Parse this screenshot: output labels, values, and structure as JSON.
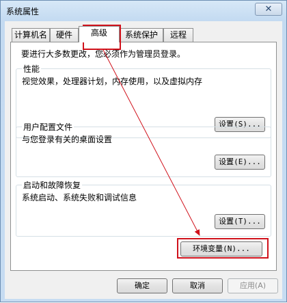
{
  "window": {
    "title": "系统属性",
    "close_glyph": "✕"
  },
  "tabs": [
    {
      "label": "计算机名",
      "active": false
    },
    {
      "label": "硬件",
      "active": false
    },
    {
      "label": "高级",
      "active": true
    },
    {
      "label": "系统保护",
      "active": false
    },
    {
      "label": "远程",
      "active": false
    }
  ],
  "admin_note": "要进行大多数更改，您必须作为管理员登录。",
  "groups": {
    "performance": {
      "title": "性能",
      "description": "视觉效果，处理器计划，内存使用，以及虚拟内存",
      "button": "设置(S)..."
    },
    "user_profiles": {
      "title": "用户配置文件",
      "description": "与您登录有关的桌面设置",
      "button": "设置(E)..."
    },
    "startup_recovery": {
      "title": "启动和故障恢复",
      "description": "系统启动、系统失败和调试信息",
      "button": "设置(T)..."
    }
  },
  "env_button": "环境变量(N)...",
  "footer": {
    "ok": "确定",
    "cancel": "取消",
    "apply": "应用(A)"
  },
  "annotation": {
    "color": "#d0111b"
  }
}
